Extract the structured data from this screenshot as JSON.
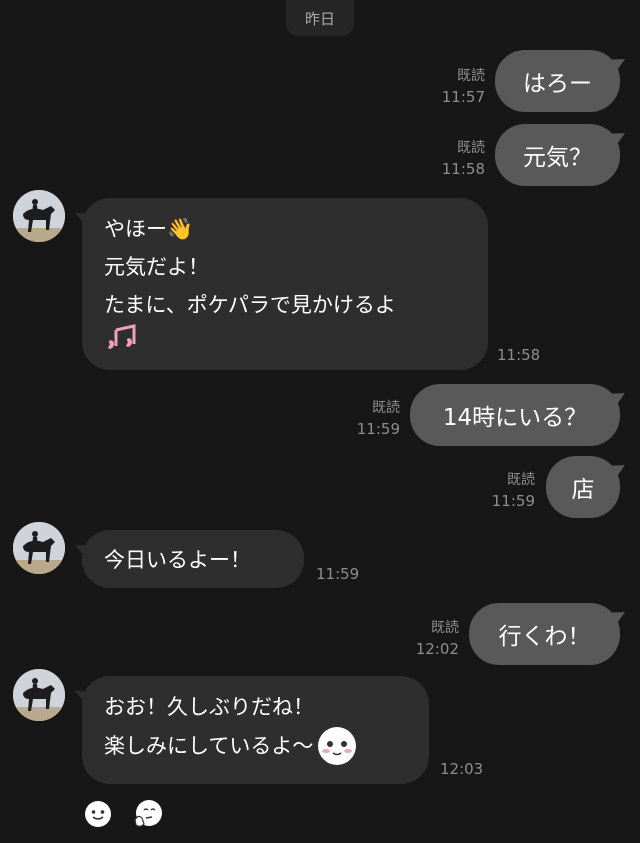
{
  "date_separator": "昨日",
  "messages": {
    "m1": {
      "text": "はろー",
      "read": "既読",
      "time": "11:57"
    },
    "m2": {
      "text": "元気？",
      "read": "既読",
      "time": "11:58"
    },
    "m3": {
      "lines": [
        "やほー👋",
        "元気だよ！",
        "たまに、ポケパラで見かけるよ"
      ],
      "time": "11:58"
    },
    "m4": {
      "text": "14時にいる？",
      "read": "既読",
      "time": "11:59"
    },
    "m5": {
      "text": "店",
      "read": "既読",
      "time": "11:59"
    },
    "m6": {
      "text": "今日いるよー！",
      "time": "11:59"
    },
    "m7": {
      "text": "行くわ！",
      "read": "既読",
      "time": "12:02"
    },
    "m8": {
      "lines": [
        "おお！久しぶりだね！",
        "楽しみにしているよ〜"
      ],
      "time": "12:03"
    }
  },
  "icons": {
    "note": "music-notes-icon",
    "emoji": "blushing-face-icon",
    "reaction1": "smile-reaction-icon",
    "reaction2": "thinking-reaction-icon"
  },
  "colors": {
    "background": "#171717",
    "outgoing_bubble": "#595959",
    "incoming_bubble": "#2e2e2e",
    "meta_text": "#8e8e8e"
  }
}
